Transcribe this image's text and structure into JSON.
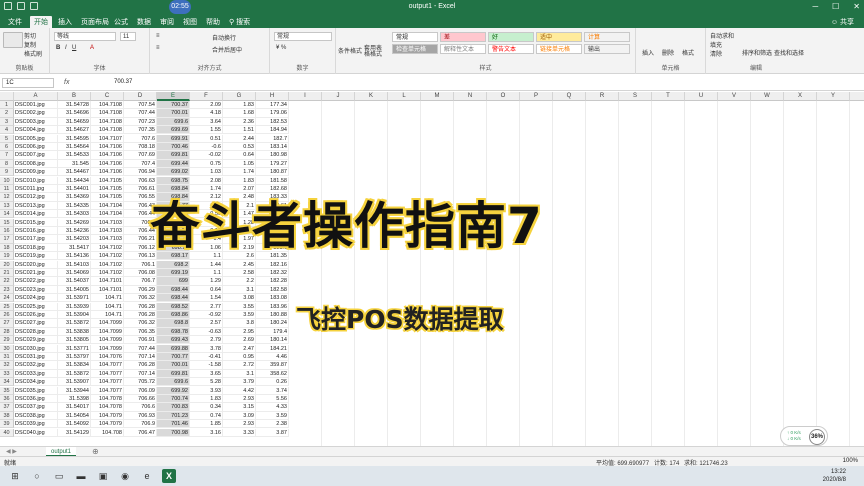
{
  "window": {
    "title": "output1 - Excel",
    "recording_badge": "02:55",
    "share": "共享"
  },
  "tabs": [
    "文件",
    "开始",
    "插入",
    "页面布局",
    "公式",
    "数据",
    "审阅",
    "视图",
    "帮助",
    "搜索"
  ],
  "ribbon": {
    "clipboard": {
      "cut": "剪切",
      "copy": "复制",
      "format_painter": "格式刷",
      "label": "剪贴板"
    },
    "font": {
      "name": "等线",
      "size": "11",
      "label": "字体"
    },
    "alignment": {
      "wrap": "自动换行",
      "merge": "合并后居中",
      "label": "对齐方式"
    },
    "number": {
      "format": "常规",
      "label": "数字"
    },
    "styles": {
      "cond_format": "条件格式",
      "table_format": "套用表格格式",
      "cells": [
        {
          "text": "常规",
          "bg": "#ffffff",
          "fg": "#222222"
        },
        {
          "text": "差",
          "bg": "#ffc7ce",
          "fg": "#9c0006"
        },
        {
          "text": "好",
          "bg": "#c6efce",
          "fg": "#006100"
        },
        {
          "text": "适中",
          "bg": "#ffeb9c",
          "fg": "#9c5700"
        },
        {
          "text": "计算",
          "bg": "#f2f2f2",
          "fg": "#fa7d00"
        },
        {
          "text": "检查单元格",
          "bg": "#a5a5a5",
          "fg": "#ffffff"
        },
        {
          "text": "解释性文本",
          "bg": "#ffffff",
          "fg": "#7f7f7f"
        },
        {
          "text": "警告文本",
          "bg": "#ffffff",
          "fg": "#ff0000"
        },
        {
          "text": "链接单元格",
          "bg": "#ffffff",
          "fg": "#fa7d00"
        },
        {
          "text": "输出",
          "bg": "#f2f2f2",
          "fg": "#3f3f3f"
        }
      ],
      "label": "样式"
    },
    "cells_group": {
      "insert": "插入",
      "delete": "删除",
      "format": "格式",
      "label": "单元格"
    },
    "editing": {
      "autosum": "自动求和",
      "fill": "填充",
      "clear": "清除",
      "sort": "排序和筛选",
      "find": "查找和选择",
      "label": "编辑"
    }
  },
  "formula_bar": {
    "name_box": "1C",
    "fx": "fx",
    "value": "700.37"
  },
  "columns": [
    "A",
    "B",
    "C",
    "D",
    "E",
    "F",
    "G",
    "H",
    "I",
    "J",
    "K",
    "L",
    "M",
    "N",
    "O",
    "P",
    "Q",
    "R",
    "S",
    "T",
    "U",
    "V",
    "W",
    "X",
    "Y",
    "Z"
  ],
  "rows": [
    [
      "DSC001.jpg",
      "31.54728",
      "104.7108",
      "707.54",
      "700.37",
      "2.09",
      "1.83",
      "177.34"
    ],
    [
      "DSC002.jpg",
      "31.54696",
      "104.7108",
      "707.44",
      "700.01",
      "4.18",
      "1.68",
      "179.06"
    ],
    [
      "DSC003.jpg",
      "31.54659",
      "104.7108",
      "707.23",
      "699.6",
      "3.64",
      "2.36",
      "182.53"
    ],
    [
      "DSC004.jpg",
      "31.54627",
      "104.7108",
      "707.35",
      "699.69",
      "1.55",
      "1.51",
      "184.94"
    ],
    [
      "DSC005.jpg",
      "31.54595",
      "104.7107",
      "707.6",
      "699.91",
      "0.51",
      "2.44",
      "182.7"
    ],
    [
      "DSC006.jpg",
      "31.54564",
      "104.7106",
      "708.18",
      "700.46",
      "-0.6",
      "0.53",
      "183.14"
    ],
    [
      "DSC007.jpg",
      "31.54533",
      "104.7106",
      "707.69",
      "699.81",
      "-0.02",
      "0.64",
      "180.98"
    ],
    [
      "DSC008.jpg",
      "31.545",
      "104.7106",
      "707.4",
      "699.44",
      "0.75",
      "1.05",
      "179.27"
    ],
    [
      "DSC009.jpg",
      "31.54467",
      "104.7106",
      "706.94",
      "699.02",
      "1.03",
      "1.74",
      "180.87"
    ],
    [
      "DSC010.jpg",
      "31.54434",
      "104.7105",
      "706.63",
      "698.75",
      "2.08",
      "1.83",
      "181.58"
    ],
    [
      "DSC011.jpg",
      "31.54401",
      "104.7105",
      "706.61",
      "698.84",
      "1.74",
      "2.07",
      "182.68"
    ],
    [
      "DSC012.jpg",
      "31.54369",
      "104.7105",
      "706.55",
      "698.84",
      "2.12",
      "2.48",
      "183.33"
    ],
    [
      "DSC013.jpg",
      "31.54335",
      "104.7104",
      "706.43",
      "698.77",
      "0.61",
      "2.1",
      "183.61"
    ],
    [
      "DSC014.jpg",
      "31.54303",
      "104.7104",
      "706.44",
      "698.59",
      "0.56",
      "1.47",
      "181.4"
    ],
    [
      "DSC015.jpg",
      "31.54269",
      "104.7103",
      "706.4",
      "698.47",
      "1.11",
      "1.28",
      "180.63"
    ],
    [
      "DSC016.jpg",
      "31.54236",
      "104.7103",
      "706.44",
      "698.51",
      "0.93",
      "1.68",
      "180.2"
    ],
    [
      "DSC017.jpg",
      "31.54203",
      "104.7103",
      "706.21",
      "698.28",
      "1.4",
      "1.97",
      "180.73"
    ],
    [
      "DSC018.jpg",
      "31.5417",
      "104.7102",
      "706.12",
      "698.11",
      "1.06",
      "2.19",
      "181.6"
    ],
    [
      "DSC019.jpg",
      "31.54136",
      "104.7102",
      "706.13",
      "698.17",
      "1.1",
      "2.6",
      "181.35"
    ],
    [
      "DSC020.jpg",
      "31.54103",
      "104.7102",
      "706.1",
      "698.2",
      "1.44",
      "2.45",
      "182.16"
    ],
    [
      "DSC021.jpg",
      "31.54069",
      "104.7102",
      "706.08",
      "699.19",
      "1.1",
      "2.58",
      "182.32"
    ],
    [
      "DSC022.jpg",
      "31.54037",
      "104.7101",
      "706.7",
      "699",
      "1.29",
      "2.2",
      "182.28"
    ],
    [
      "DSC023.jpg",
      "31.54005",
      "104.7101",
      "706.29",
      "698.44",
      "0.64",
      "3.1",
      "182.58"
    ],
    [
      "DSC024.jpg",
      "31.53971",
      "104.71",
      "706.32",
      "698.44",
      "1.54",
      "3.08",
      "183.08"
    ],
    [
      "DSC025.jpg",
      "31.53939",
      "104.71",
      "706.28",
      "698.52",
      "2.77",
      "3.55",
      "183.96"
    ],
    [
      "DSC026.jpg",
      "31.53904",
      "104.71",
      "706.28",
      "698.86",
      "-0.92",
      "3.59",
      "180.88"
    ],
    [
      "DSC027.jpg",
      "31.53872",
      "104.7099",
      "706.32",
      "698.8",
      "2.57",
      "3.8",
      "180.24"
    ],
    [
      "DSC028.jpg",
      "31.53838",
      "104.7099",
      "706.35",
      "698.78",
      "-0.63",
      "2.95",
      "179.4"
    ],
    [
      "DSC029.jpg",
      "31.53805",
      "104.7099",
      "706.91",
      "699.43",
      "2.79",
      "2.69",
      "180.14"
    ],
    [
      "DSC030.jpg",
      "31.53771",
      "104.7099",
      "707.44",
      "699.88",
      "3.78",
      "2.47",
      "184.21"
    ],
    [
      "DSC031.jpg",
      "31.53797",
      "104.7076",
      "707.14",
      "700.77",
      "-0.41",
      "0.95",
      "4.46"
    ],
    [
      "DSC032.jpg",
      "31.53834",
      "104.7077",
      "706.28",
      "700.01",
      "-1.58",
      "2.72",
      "359.87"
    ],
    [
      "DSC033.jpg",
      "31.53872",
      "104.7077",
      "707.14",
      "699.81",
      "3.65",
      "3.1",
      "358.62"
    ],
    [
      "DSC034.jpg",
      "31.53907",
      "104.7077",
      "705.72",
      "699.6",
      "5.28",
      "3.79",
      "0.26"
    ],
    [
      "DSC035.jpg",
      "31.53944",
      "104.7077",
      "706.09",
      "699.92",
      "3.93",
      "4.42",
      "3.74"
    ],
    [
      "DSC036.jpg",
      "31.5398",
      "104.7078",
      "706.66",
      "700.74",
      "1.83",
      "2.93",
      "5.56"
    ],
    [
      "DSC037.jpg",
      "31.54017",
      "104.7078",
      "706.6",
      "700.83",
      "0.34",
      "3.15",
      "4.33"
    ],
    [
      "DSC038.jpg",
      "31.54054",
      "104.7079",
      "706.93",
      "701.23",
      "0.74",
      "3.09",
      "3.59"
    ],
    [
      "DSC039.jpg",
      "31.54092",
      "104.7079",
      "706.9",
      "701.46",
      "1.85",
      "2.93",
      "2.38"
    ],
    [
      "DSC040.jpg",
      "31.54129",
      "104.708",
      "706.47",
      "700.98",
      "3.16",
      "3.33",
      "3.87"
    ]
  ],
  "overlay": {
    "title": "奋斗者操作指南7",
    "subtitle": "飞控POS数据提取"
  },
  "speed_widget": {
    "up": "0 K/s",
    "down": "0 K/s",
    "percent": "36%"
  },
  "sheet_tab": "output1",
  "status": {
    "ready": "就绪",
    "average": "平均值: 699.690977",
    "count": "计数: 174",
    "sum": "求和: 121746.23",
    "zoom": "100%"
  },
  "taskbar": {
    "time": "13:22",
    "date": "2020/8/8"
  }
}
